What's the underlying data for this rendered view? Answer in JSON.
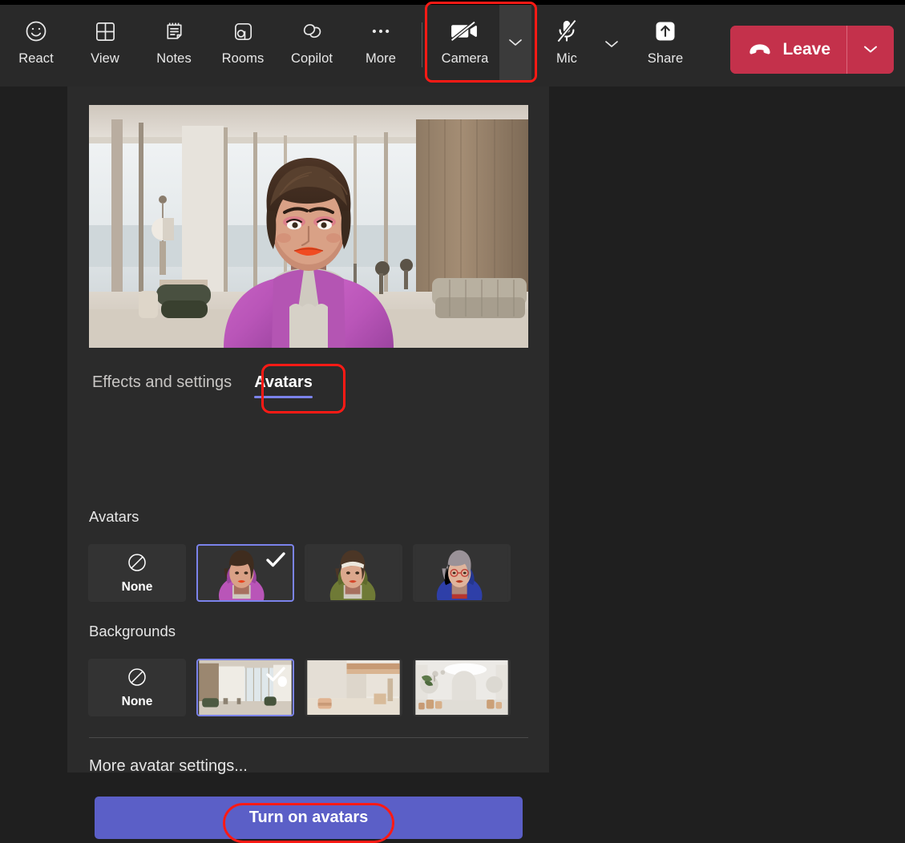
{
  "toolbar": {
    "buttons": [
      {
        "label": "React",
        "icon": "smiley-face-icon"
      },
      {
        "label": "View",
        "icon": "grid-layout-icon"
      },
      {
        "label": "Notes",
        "icon": "notepad-icon"
      },
      {
        "label": "Rooms",
        "icon": "breakout-rooms-icon"
      },
      {
        "label": "Copilot",
        "icon": "copilot-icon"
      },
      {
        "label": "More",
        "icon": "ellipsis-icon"
      }
    ],
    "camera": {
      "label": "Camera",
      "icon": "camera-off-icon",
      "chevron_icon": "chevron-down-icon",
      "highlighted": "true"
    },
    "mic": {
      "label": "Mic",
      "icon": "mic-off-icon",
      "chevron_icon": "chevron-down-icon"
    },
    "share": {
      "label": "Share",
      "icon": "share-screen-icon"
    },
    "leave": {
      "label": "Leave",
      "icon": "hang-up-icon",
      "chevron_icon": "chevron-down-icon"
    }
  },
  "panel": {
    "preview": {
      "name": "avatar-video-preview"
    },
    "tabs": [
      {
        "label": "Effects and settings",
        "active": false
      },
      {
        "label": "Avatars",
        "active": true
      }
    ],
    "avatars_section": {
      "label": "Avatars",
      "items": [
        {
          "label": "None",
          "type": "none",
          "selected": false
        },
        {
          "label": "Avatar 1",
          "type": "avatar",
          "selected": true
        },
        {
          "label": "Avatar 2",
          "type": "avatar",
          "selected": false
        },
        {
          "label": "Avatar 3",
          "type": "avatar",
          "selected": false
        }
      ]
    },
    "backgrounds_section": {
      "label": "Backgrounds",
      "items": [
        {
          "label": "None",
          "type": "none",
          "selected": false
        },
        {
          "label": "Background 1",
          "type": "background",
          "selected": true
        },
        {
          "label": "Background 2",
          "type": "background",
          "selected": false
        },
        {
          "label": "Background 3",
          "type": "background",
          "selected": false
        }
      ]
    },
    "more_settings_label": "More avatar settings...",
    "cta_label": "Turn on avatars"
  },
  "colors": {
    "accent": "#5b5fc7",
    "tab_underline": "#7b83eb",
    "leave_red": "#c4314b",
    "highlight_red": "#ff1a15",
    "panel_bg": "#2b2b2b",
    "toolbar_bg": "#292929",
    "app_bg": "#1f1f1f"
  }
}
